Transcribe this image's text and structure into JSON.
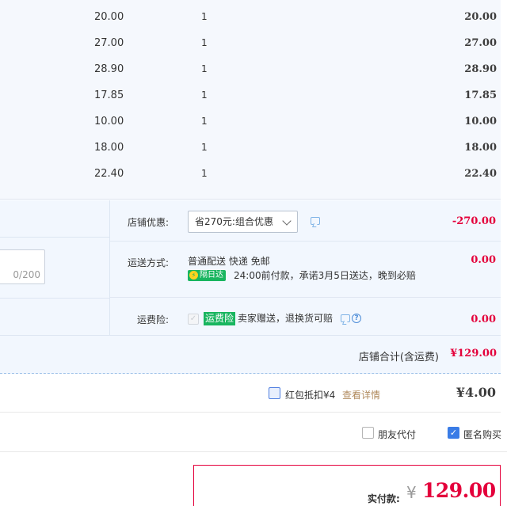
{
  "items": [
    {
      "price": "20.00",
      "qty": "1",
      "subtotal": "20.00"
    },
    {
      "price": "27.00",
      "qty": "1",
      "subtotal": "27.00"
    },
    {
      "price": "28.90",
      "qty": "1",
      "subtotal": "28.90"
    },
    {
      "price": "17.85",
      "qty": "1",
      "subtotal": "17.85"
    },
    {
      "price": "10.00",
      "qty": "1",
      "subtotal": "10.00"
    },
    {
      "price": "18.00",
      "qty": "1",
      "subtotal": "18.00"
    },
    {
      "price": "22.40",
      "qty": "1",
      "subtotal": "22.40"
    }
  ],
  "message": {
    "count": "0/200"
  },
  "discount": {
    "label": "店铺优惠:",
    "selected": "省270元:组合优惠",
    "amount": "-270.00"
  },
  "shipping": {
    "label": "运送方式:",
    "method": "普通配送 快递 免邮",
    "badge": "隔日达",
    "promise": "24:00前付款，承诺3月5日送达，晚到必赔",
    "amount": "0.00"
  },
  "insurance": {
    "label": "运费险:",
    "badge": "运费险",
    "desc": "卖家赠送，退换货可赔",
    "amount": "0.00"
  },
  "shop_total": {
    "label": "店铺合计(含运费)",
    "value": "¥129.00"
  },
  "red_packet": {
    "label": "红包抵扣¥4",
    "detail_link": "查看详情",
    "value": "¥4.00"
  },
  "options": {
    "friend_pay": "朋友代付",
    "anonymous": "匿名购买"
  },
  "payment": {
    "label": "实付款:",
    "currency": "¥",
    "value": "129.00"
  },
  "colors": {
    "accent_red": "#e4003b",
    "green_badge": "#19b55f",
    "link_brown": "#b08a5d",
    "check_blue": "#3a7ce6"
  }
}
